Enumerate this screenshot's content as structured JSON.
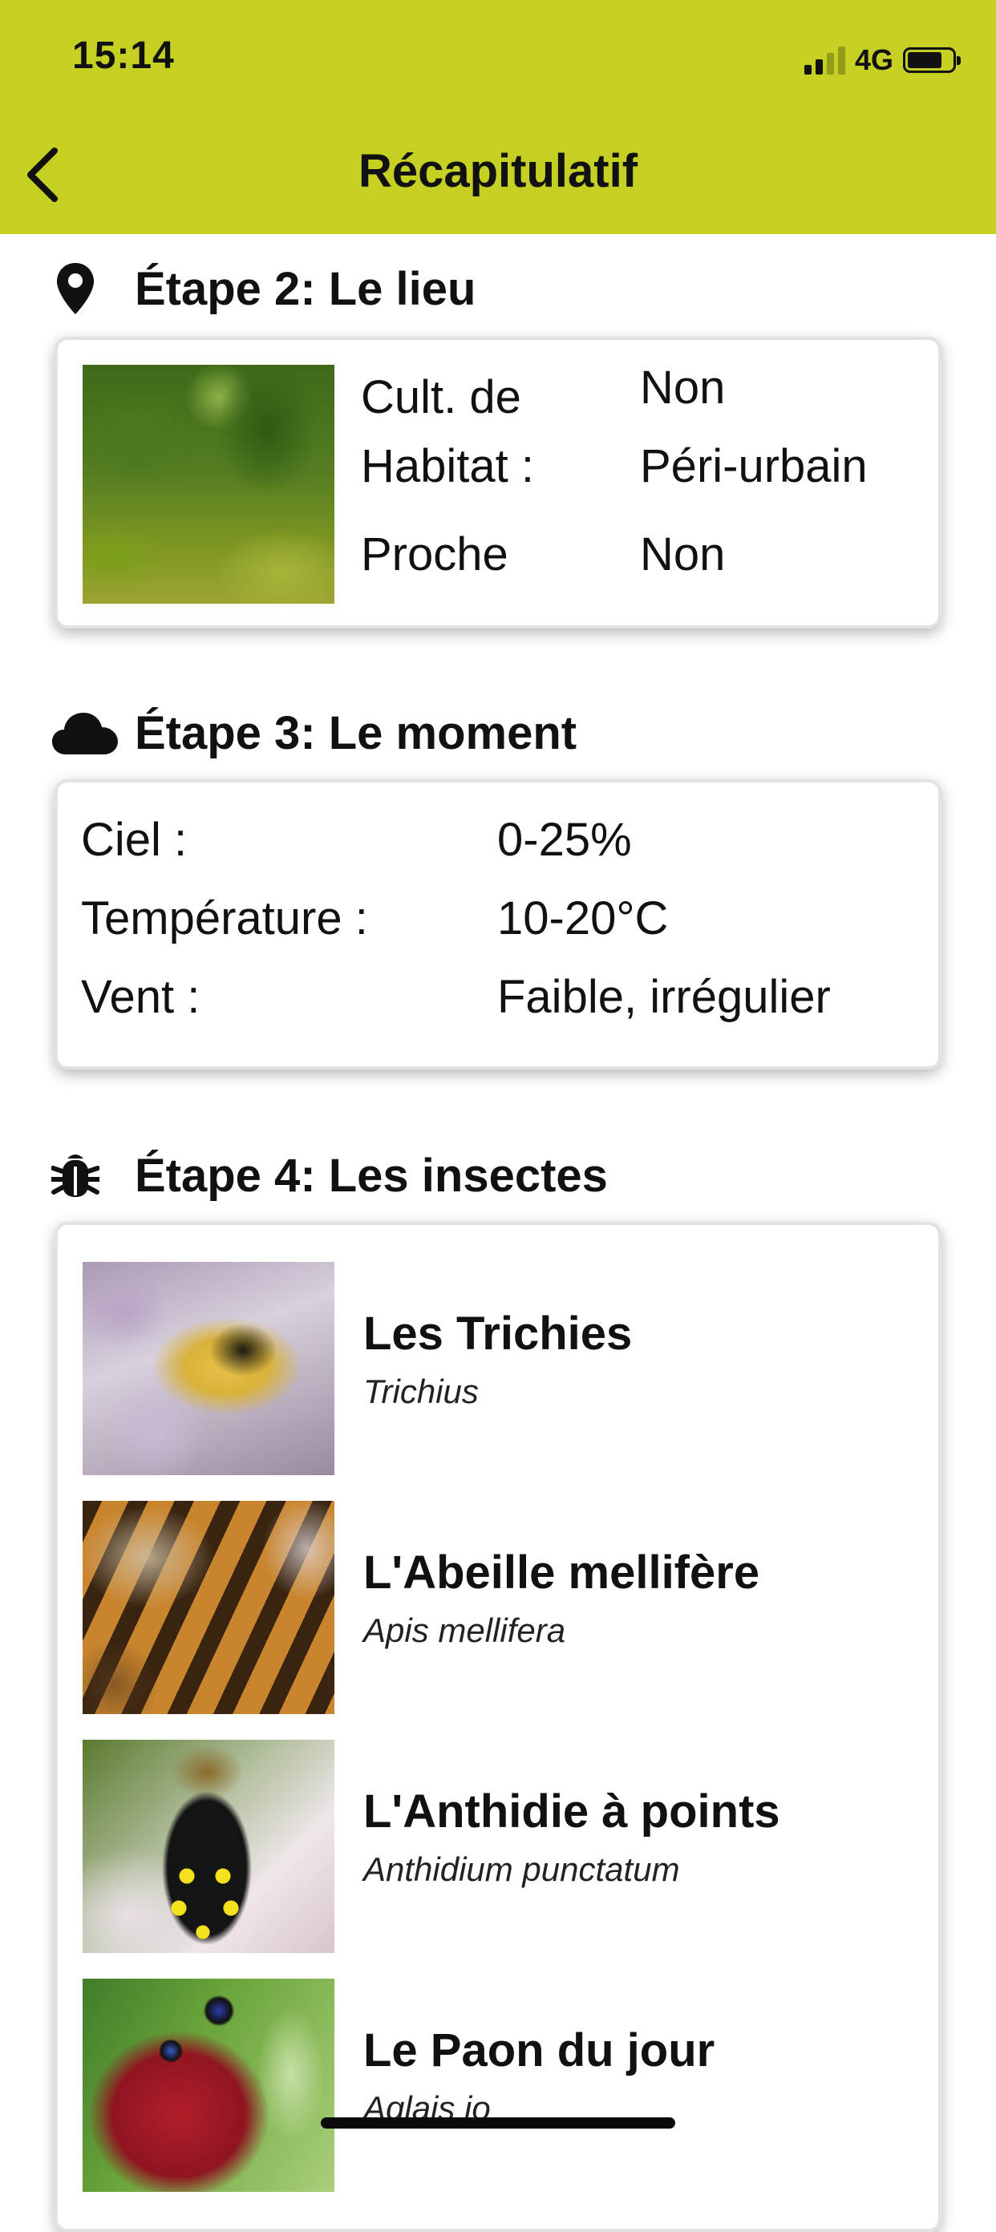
{
  "status_bar": {
    "time": "15:14",
    "network": "4G"
  },
  "header": {
    "title": "Récapitulatif",
    "background_color": "#c5d023"
  },
  "step2": {
    "title": "Étape 2: Le lieu",
    "icon": "location-pin-icon",
    "rows": [
      {
        "label": "Cult. de",
        "value": "Non"
      },
      {
        "label": "Habitat :",
        "value": "Péri-urbain"
      },
      {
        "label": "Proche",
        "value": "Non"
      }
    ]
  },
  "step3": {
    "title": "Étape 3: Le moment",
    "icon": "cloud-icon",
    "rows": [
      {
        "label": "Ciel :",
        "value": "0-25%"
      },
      {
        "label": "Température :",
        "value": "10-20°C"
      },
      {
        "label": "Vent :",
        "value": "Faible, irrégulier"
      }
    ]
  },
  "step4": {
    "title": "Étape 4: Les insectes",
    "icon": "bug-icon",
    "insects": [
      {
        "name": "Les Trichies",
        "latin": "Trichius"
      },
      {
        "name": "L'Abeille mellifère",
        "latin": "Apis mellifera"
      },
      {
        "name": "L'Anthidie à points",
        "latin": "Anthidium punctatum"
      },
      {
        "name": "Le Paon du jour",
        "latin": "Aglais io"
      }
    ]
  }
}
